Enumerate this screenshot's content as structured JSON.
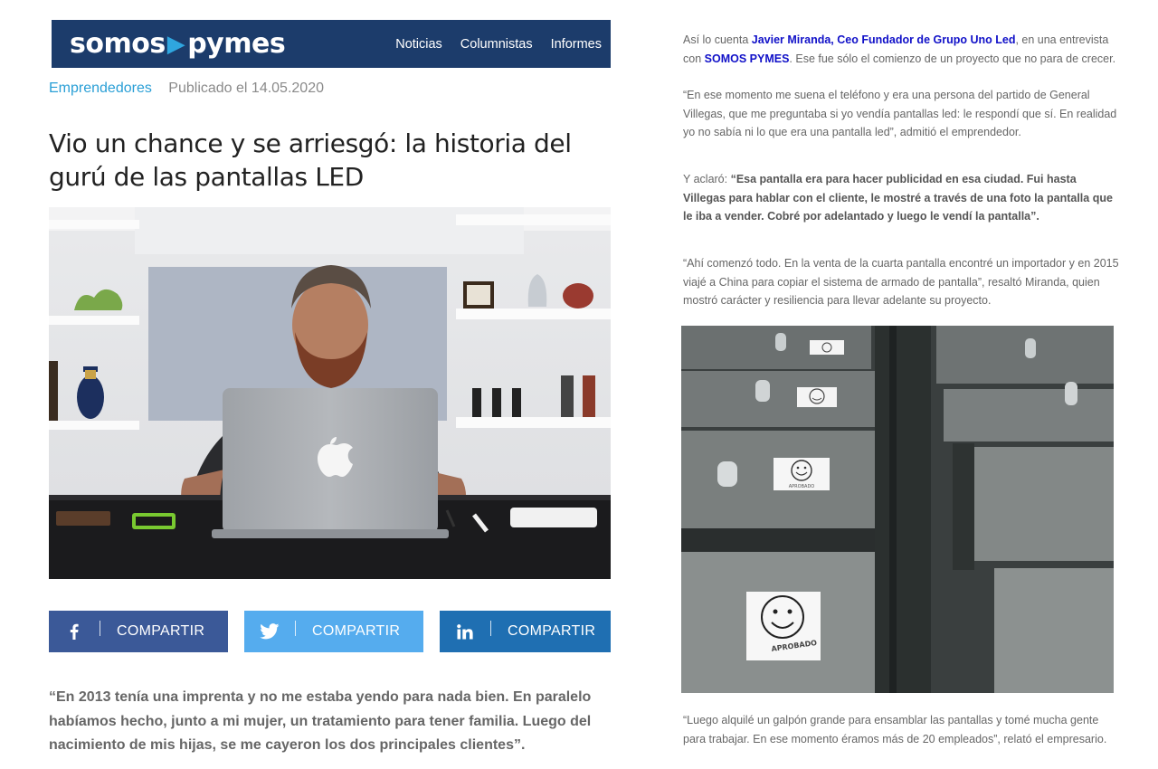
{
  "header": {
    "logo_left": "somos",
    "logo_right": "pymes",
    "nav": [
      "Noticias",
      "Columnistas",
      "Informes"
    ]
  },
  "article": {
    "category": "Emprendedores",
    "published": "Publicado el 14.05.2020",
    "title": "Vio un chance y se arriesgó: la historia del gurú de las pantallas LED",
    "lead_quote": "“En 2013 tenía una imprenta y no me estaba yendo para nada bien. En paralelo habíamos hecho, junto a mi mujer, un tratamiento para tener familia. Luego del nacimiento de mis hijas, se me cayeron los dos principales clientes”."
  },
  "share": {
    "facebook_label": "COMPARTIR",
    "twitter_label": "COMPARTIR",
    "linkedin_label": "COMPARTIR"
  },
  "body": {
    "p1_prefix": "Así lo cuenta ",
    "p1_link1": "Javier Miranda, Ceo Fundador de Grupo Uno Led",
    "p1_mid": ", en una entrevista con ",
    "p1_link2": "SOMOS PYMES",
    "p1_suffix": ". Ese fue sólo el comienzo de un proyecto que no para de crecer.",
    "p2": "“En ese momento me suena el teléfono y era una persona del partido de General Villegas, que me preguntaba si yo vendía pantallas led: le respondí que sí. En realidad yo no sabía ni lo que era una pantalla led”, admitió el emprendedor.",
    "p3_prefix": "Y aclaró: ",
    "p3_bold": "“Esa pantalla era para hacer publicidad en esa ciudad. Fui hasta Villegas para hablar con el cliente, le mostré a través de una foto la pantalla que le iba a vender. Cobré por adelantado y luego le vendí la pantalla”.",
    "p4": "“Ahí comenzó todo. En la venta de la cuarta pantalla encontré un importador y en 2015 viajé a China para copiar el sistema de armado de pantalla”, resaltó Miranda, quien mostró carácter y resiliencia para llevar adelante su proyecto.",
    "p5": "“Luego alquilé un galpón grande para ensamblar las pantallas y tomé mucha gente para trabajar. En ese momento éramos más de 20 empleados”, relató el empresario."
  },
  "stickers": {
    "label": "APROBADO"
  },
  "colors": {
    "navbar": "#1c3c6b",
    "accent": "#2a9fd6",
    "facebook": "#3b5998",
    "twitter": "#55acee",
    "linkedin": "#1f6fb2",
    "link": "#1010c8"
  }
}
